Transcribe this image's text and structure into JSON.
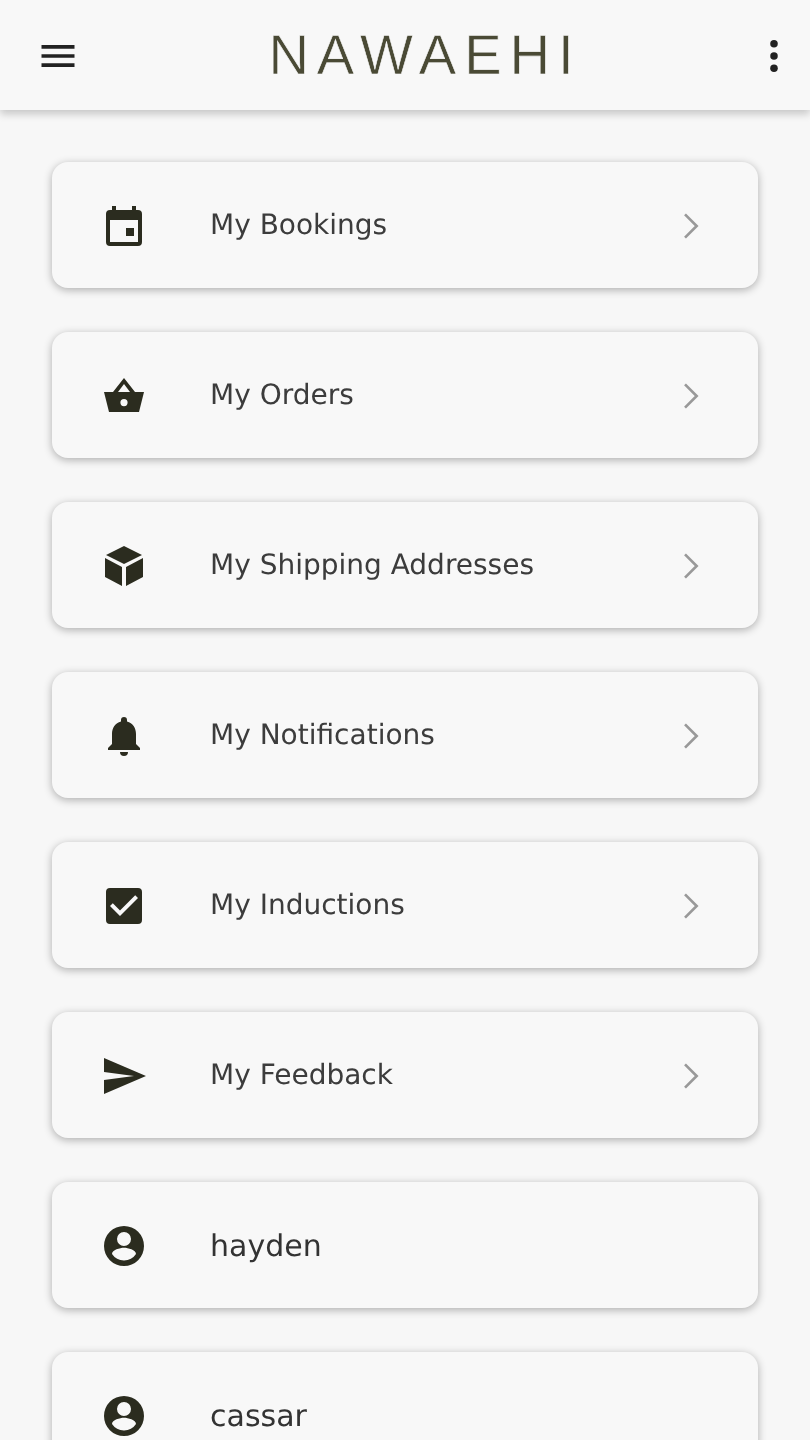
{
  "app_bar": {
    "logo": "NAWAEHI"
  },
  "items": [
    {
      "label": "My Bookings",
      "kind": "link"
    },
    {
      "label": "My Orders",
      "kind": "link"
    },
    {
      "label": "My Shipping Addresses",
      "kind": "link"
    },
    {
      "label": "My Notifications",
      "kind": "link"
    },
    {
      "label": "My Inductions",
      "kind": "link"
    },
    {
      "label": "My Feedback",
      "kind": "link"
    },
    {
      "label": "hayden",
      "kind": "profile"
    },
    {
      "label": "cassar",
      "kind": "profile"
    }
  ]
}
